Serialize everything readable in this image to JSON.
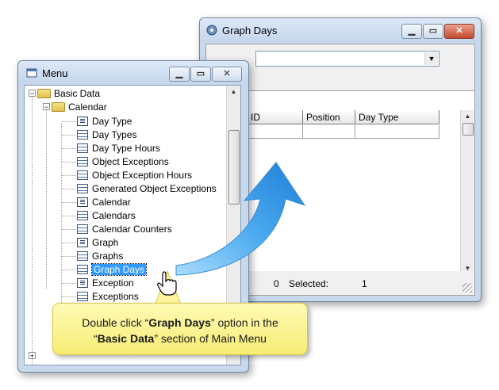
{
  "graph_days_window": {
    "title": "Graph Days",
    "columns": [
      "ID",
      "Position",
      "Day Type"
    ],
    "status": {
      "count": "0",
      "selected_label": "Selected:",
      "selected_value": "1"
    }
  },
  "menu_window": {
    "title": "Menu",
    "tree": [
      {
        "label": "Basic Data",
        "level": 0,
        "icon": "folder-open-icon"
      },
      {
        "label": "Calendar",
        "level": 1,
        "icon": "folder-open-icon"
      },
      {
        "label": "Day Type",
        "level": 2,
        "icon": "form-icon"
      },
      {
        "label": "Day Types",
        "level": 2,
        "icon": "table-icon"
      },
      {
        "label": "Day Type Hours",
        "level": 2,
        "icon": "table-icon"
      },
      {
        "label": "Object Exceptions",
        "level": 2,
        "icon": "table-icon"
      },
      {
        "label": "Object Exception Hours",
        "level": 2,
        "icon": "table-icon"
      },
      {
        "label": "Generated Object Exceptions",
        "level": 2,
        "icon": "table-icon"
      },
      {
        "label": "Calendar",
        "level": 2,
        "icon": "form-icon"
      },
      {
        "label": "Calendars",
        "level": 2,
        "icon": "table-icon"
      },
      {
        "label": "Calendar Counters",
        "level": 2,
        "icon": "table-icon"
      },
      {
        "label": "Graph",
        "level": 2,
        "icon": "form-icon"
      },
      {
        "label": "Graphs",
        "level": 2,
        "icon": "table-icon"
      },
      {
        "label": "Graph Days",
        "level": 2,
        "icon": "table-icon",
        "selected": true
      },
      {
        "label": "Exception",
        "level": 2,
        "icon": "form-icon"
      },
      {
        "label": "Exceptions",
        "level": 2,
        "icon": "table-icon"
      }
    ]
  },
  "callout": {
    "line1_pre": "Double click “",
    "line1_bold": "Graph Days",
    "line1_post": "” option in the",
    "line2_pre": "“",
    "line2_bold": "Basic Data",
    "line2_post": "” section of Main Menu"
  },
  "colors": {
    "selection": "#3399ff",
    "arrow": "#2a8fe0",
    "callout": "#f9f08a"
  }
}
